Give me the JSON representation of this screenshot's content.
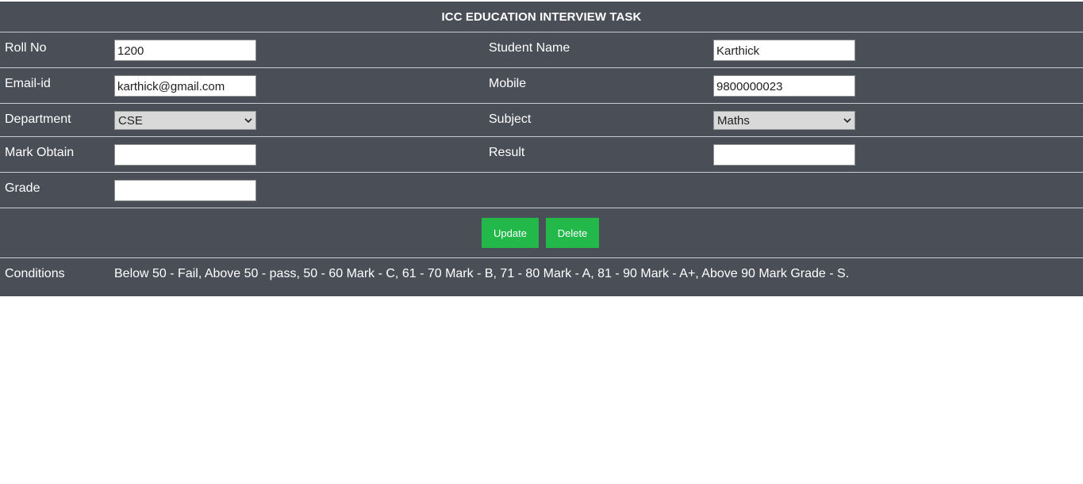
{
  "header": {
    "title": "ICC EDUCATION INTERVIEW TASK"
  },
  "form": {
    "roll_no": {
      "label": "Roll No",
      "value": "1200"
    },
    "student_name": {
      "label": "Student Name",
      "value": "Karthick"
    },
    "email": {
      "label": "Email-id",
      "value": "karthick@gmail.com"
    },
    "mobile": {
      "label": "Mobile",
      "value": "9800000023"
    },
    "department": {
      "label": "Department",
      "selected": "CSE"
    },
    "subject": {
      "label": "Subject",
      "selected": "Maths"
    },
    "mark_obtain": {
      "label": "Mark Obtain",
      "value": ""
    },
    "result": {
      "label": "Result",
      "value": ""
    },
    "grade": {
      "label": "Grade",
      "value": ""
    }
  },
  "actions": {
    "update_label": "Update",
    "delete_label": "Delete"
  },
  "conditions": {
    "label": "Conditions",
    "text": "Below 50 - Fail, Above 50 - pass, 50 - 60 Mark - C, 61 - 70 Mark - B, 71 - 80 Mark - A, 81 - 90 Mark - A+, Above 90 Mark Grade - S."
  },
  "colors": {
    "panel_bg": "#4a4e57",
    "button_green": "#22b84a",
    "select_bg": "#d9d9d9"
  },
  "icons": {
    "select_arrow": "chevron-down-icon"
  }
}
